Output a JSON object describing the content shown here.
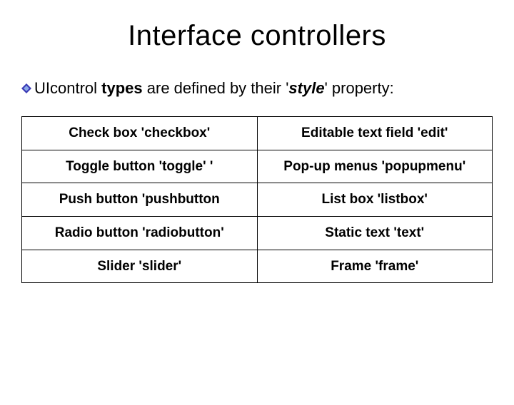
{
  "title": "Interface controllers",
  "subtitle": {
    "part1": "UIcontrol ",
    "part2_bold": "types",
    "part3": " are defined by their '",
    "part4_bolditalic": "style",
    "part5": "' property:"
  },
  "table": {
    "rows": [
      {
        "left": "Check box 'checkbox'",
        "right": "Editable text field 'edit'"
      },
      {
        "left": "Toggle button 'toggle' '",
        "right": "Pop-up menus 'popupmenu'"
      },
      {
        "left": "Push  button 'pushbutton",
        "right": "List box 'listbox'"
      },
      {
        "left": "Radio button 'radiobutton'",
        "right": "Static text 'text'"
      },
      {
        "left": "Slider 'slider'",
        "right": "Frame 'frame'"
      }
    ]
  }
}
